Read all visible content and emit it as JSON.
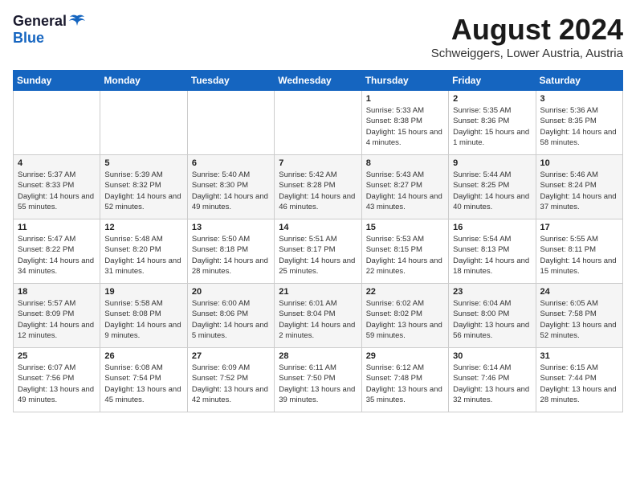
{
  "header": {
    "logo_general": "General",
    "logo_blue": "Blue",
    "title": "August 2024",
    "subtitle": "Schweiggers, Lower Austria, Austria"
  },
  "weekdays": [
    "Sunday",
    "Monday",
    "Tuesday",
    "Wednesday",
    "Thursday",
    "Friday",
    "Saturday"
  ],
  "weeks": [
    [
      {
        "day": "",
        "sunrise": "",
        "sunset": "",
        "daylight": ""
      },
      {
        "day": "",
        "sunrise": "",
        "sunset": "",
        "daylight": ""
      },
      {
        "day": "",
        "sunrise": "",
        "sunset": "",
        "daylight": ""
      },
      {
        "day": "",
        "sunrise": "",
        "sunset": "",
        "daylight": ""
      },
      {
        "day": "1",
        "sunrise": "Sunrise: 5:33 AM",
        "sunset": "Sunset: 8:38 PM",
        "daylight": "Daylight: 15 hours and 4 minutes."
      },
      {
        "day": "2",
        "sunrise": "Sunrise: 5:35 AM",
        "sunset": "Sunset: 8:36 PM",
        "daylight": "Daylight: 15 hours and 1 minute."
      },
      {
        "day": "3",
        "sunrise": "Sunrise: 5:36 AM",
        "sunset": "Sunset: 8:35 PM",
        "daylight": "Daylight: 14 hours and 58 minutes."
      }
    ],
    [
      {
        "day": "4",
        "sunrise": "Sunrise: 5:37 AM",
        "sunset": "Sunset: 8:33 PM",
        "daylight": "Daylight: 14 hours and 55 minutes."
      },
      {
        "day": "5",
        "sunrise": "Sunrise: 5:39 AM",
        "sunset": "Sunset: 8:32 PM",
        "daylight": "Daylight: 14 hours and 52 minutes."
      },
      {
        "day": "6",
        "sunrise": "Sunrise: 5:40 AM",
        "sunset": "Sunset: 8:30 PM",
        "daylight": "Daylight: 14 hours and 49 minutes."
      },
      {
        "day": "7",
        "sunrise": "Sunrise: 5:42 AM",
        "sunset": "Sunset: 8:28 PM",
        "daylight": "Daylight: 14 hours and 46 minutes."
      },
      {
        "day": "8",
        "sunrise": "Sunrise: 5:43 AM",
        "sunset": "Sunset: 8:27 PM",
        "daylight": "Daylight: 14 hours and 43 minutes."
      },
      {
        "day": "9",
        "sunrise": "Sunrise: 5:44 AM",
        "sunset": "Sunset: 8:25 PM",
        "daylight": "Daylight: 14 hours and 40 minutes."
      },
      {
        "day": "10",
        "sunrise": "Sunrise: 5:46 AM",
        "sunset": "Sunset: 8:24 PM",
        "daylight": "Daylight: 14 hours and 37 minutes."
      }
    ],
    [
      {
        "day": "11",
        "sunrise": "Sunrise: 5:47 AM",
        "sunset": "Sunset: 8:22 PM",
        "daylight": "Daylight: 14 hours and 34 minutes."
      },
      {
        "day": "12",
        "sunrise": "Sunrise: 5:48 AM",
        "sunset": "Sunset: 8:20 PM",
        "daylight": "Daylight: 14 hours and 31 minutes."
      },
      {
        "day": "13",
        "sunrise": "Sunrise: 5:50 AM",
        "sunset": "Sunset: 8:18 PM",
        "daylight": "Daylight: 14 hours and 28 minutes."
      },
      {
        "day": "14",
        "sunrise": "Sunrise: 5:51 AM",
        "sunset": "Sunset: 8:17 PM",
        "daylight": "Daylight: 14 hours and 25 minutes."
      },
      {
        "day": "15",
        "sunrise": "Sunrise: 5:53 AM",
        "sunset": "Sunset: 8:15 PM",
        "daylight": "Daylight: 14 hours and 22 minutes."
      },
      {
        "day": "16",
        "sunrise": "Sunrise: 5:54 AM",
        "sunset": "Sunset: 8:13 PM",
        "daylight": "Daylight: 14 hours and 18 minutes."
      },
      {
        "day": "17",
        "sunrise": "Sunrise: 5:55 AM",
        "sunset": "Sunset: 8:11 PM",
        "daylight": "Daylight: 14 hours and 15 minutes."
      }
    ],
    [
      {
        "day": "18",
        "sunrise": "Sunrise: 5:57 AM",
        "sunset": "Sunset: 8:09 PM",
        "daylight": "Daylight: 14 hours and 12 minutes."
      },
      {
        "day": "19",
        "sunrise": "Sunrise: 5:58 AM",
        "sunset": "Sunset: 8:08 PM",
        "daylight": "Daylight: 14 hours and 9 minutes."
      },
      {
        "day": "20",
        "sunrise": "Sunrise: 6:00 AM",
        "sunset": "Sunset: 8:06 PM",
        "daylight": "Daylight: 14 hours and 5 minutes."
      },
      {
        "day": "21",
        "sunrise": "Sunrise: 6:01 AM",
        "sunset": "Sunset: 8:04 PM",
        "daylight": "Daylight: 14 hours and 2 minutes."
      },
      {
        "day": "22",
        "sunrise": "Sunrise: 6:02 AM",
        "sunset": "Sunset: 8:02 PM",
        "daylight": "Daylight: 13 hours and 59 minutes."
      },
      {
        "day": "23",
        "sunrise": "Sunrise: 6:04 AM",
        "sunset": "Sunset: 8:00 PM",
        "daylight": "Daylight: 13 hours and 56 minutes."
      },
      {
        "day": "24",
        "sunrise": "Sunrise: 6:05 AM",
        "sunset": "Sunset: 7:58 PM",
        "daylight": "Daylight: 13 hours and 52 minutes."
      }
    ],
    [
      {
        "day": "25",
        "sunrise": "Sunrise: 6:07 AM",
        "sunset": "Sunset: 7:56 PM",
        "daylight": "Daylight: 13 hours and 49 minutes."
      },
      {
        "day": "26",
        "sunrise": "Sunrise: 6:08 AM",
        "sunset": "Sunset: 7:54 PM",
        "daylight": "Daylight: 13 hours and 45 minutes."
      },
      {
        "day": "27",
        "sunrise": "Sunrise: 6:09 AM",
        "sunset": "Sunset: 7:52 PM",
        "daylight": "Daylight: 13 hours and 42 minutes."
      },
      {
        "day": "28",
        "sunrise": "Sunrise: 6:11 AM",
        "sunset": "Sunset: 7:50 PM",
        "daylight": "Daylight: 13 hours and 39 minutes."
      },
      {
        "day": "29",
        "sunrise": "Sunrise: 6:12 AM",
        "sunset": "Sunset: 7:48 PM",
        "daylight": "Daylight: 13 hours and 35 minutes."
      },
      {
        "day": "30",
        "sunrise": "Sunrise: 6:14 AM",
        "sunset": "Sunset: 7:46 PM",
        "daylight": "Daylight: 13 hours and 32 minutes."
      },
      {
        "day": "31",
        "sunrise": "Sunrise: 6:15 AM",
        "sunset": "Sunset: 7:44 PM",
        "daylight": "Daylight: 13 hours and 28 minutes."
      }
    ]
  ]
}
